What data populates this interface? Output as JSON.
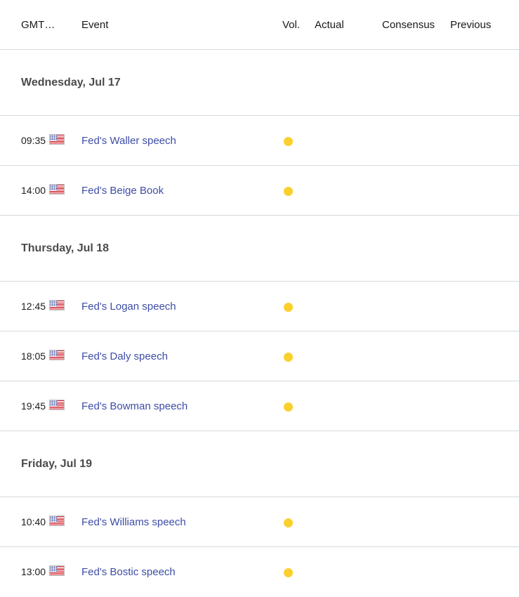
{
  "table": {
    "columns": {
      "time": "GMT…",
      "event": "Event",
      "volatility": "Vol.",
      "actual": "Actual",
      "consensus": "Consensus",
      "previous": "Previous"
    },
    "colors": {
      "event_link": "#3d4da6",
      "volatility_low": "#fbd02d",
      "divider": "#d6dadc",
      "date_heading": "#4b4b4b"
    },
    "groups": [
      {
        "date": "Wednesday, Jul 17",
        "events": [
          {
            "time": "09:35",
            "flag": "us-flag-icon",
            "country": "United States",
            "name": "Fed's Waller speech",
            "volatility": "low",
            "actual": "",
            "consensus": "",
            "previous": ""
          },
          {
            "time": "14:00",
            "flag": "us-flag-icon",
            "country": "United States",
            "name": "Fed's Beige Book",
            "volatility": "low",
            "actual": "",
            "consensus": "",
            "previous": ""
          }
        ]
      },
      {
        "date": "Thursday, Jul 18",
        "events": [
          {
            "time": "12:45",
            "flag": "us-flag-icon",
            "country": "United States",
            "name": "Fed's Logan speech",
            "volatility": "low",
            "actual": "",
            "consensus": "",
            "previous": ""
          },
          {
            "time": "18:05",
            "flag": "us-flag-icon",
            "country": "United States",
            "name": "Fed's Daly speech",
            "volatility": "low",
            "actual": "",
            "consensus": "",
            "previous": ""
          },
          {
            "time": "19:45",
            "flag": "us-flag-icon",
            "country": "United States",
            "name": "Fed's Bowman speech",
            "volatility": "low",
            "actual": "",
            "consensus": "",
            "previous": ""
          }
        ]
      },
      {
        "date": "Friday, Jul 19",
        "events": [
          {
            "time": "10:40",
            "flag": "us-flag-icon",
            "country": "United States",
            "name": "Fed's Williams speech",
            "volatility": "low",
            "actual": "",
            "consensus": "",
            "previous": ""
          },
          {
            "time": "13:00",
            "flag": "us-flag-icon",
            "country": "United States",
            "name": "Fed's Bostic speech",
            "volatility": "low",
            "actual": "",
            "consensus": "",
            "previous": ""
          }
        ]
      }
    ]
  }
}
